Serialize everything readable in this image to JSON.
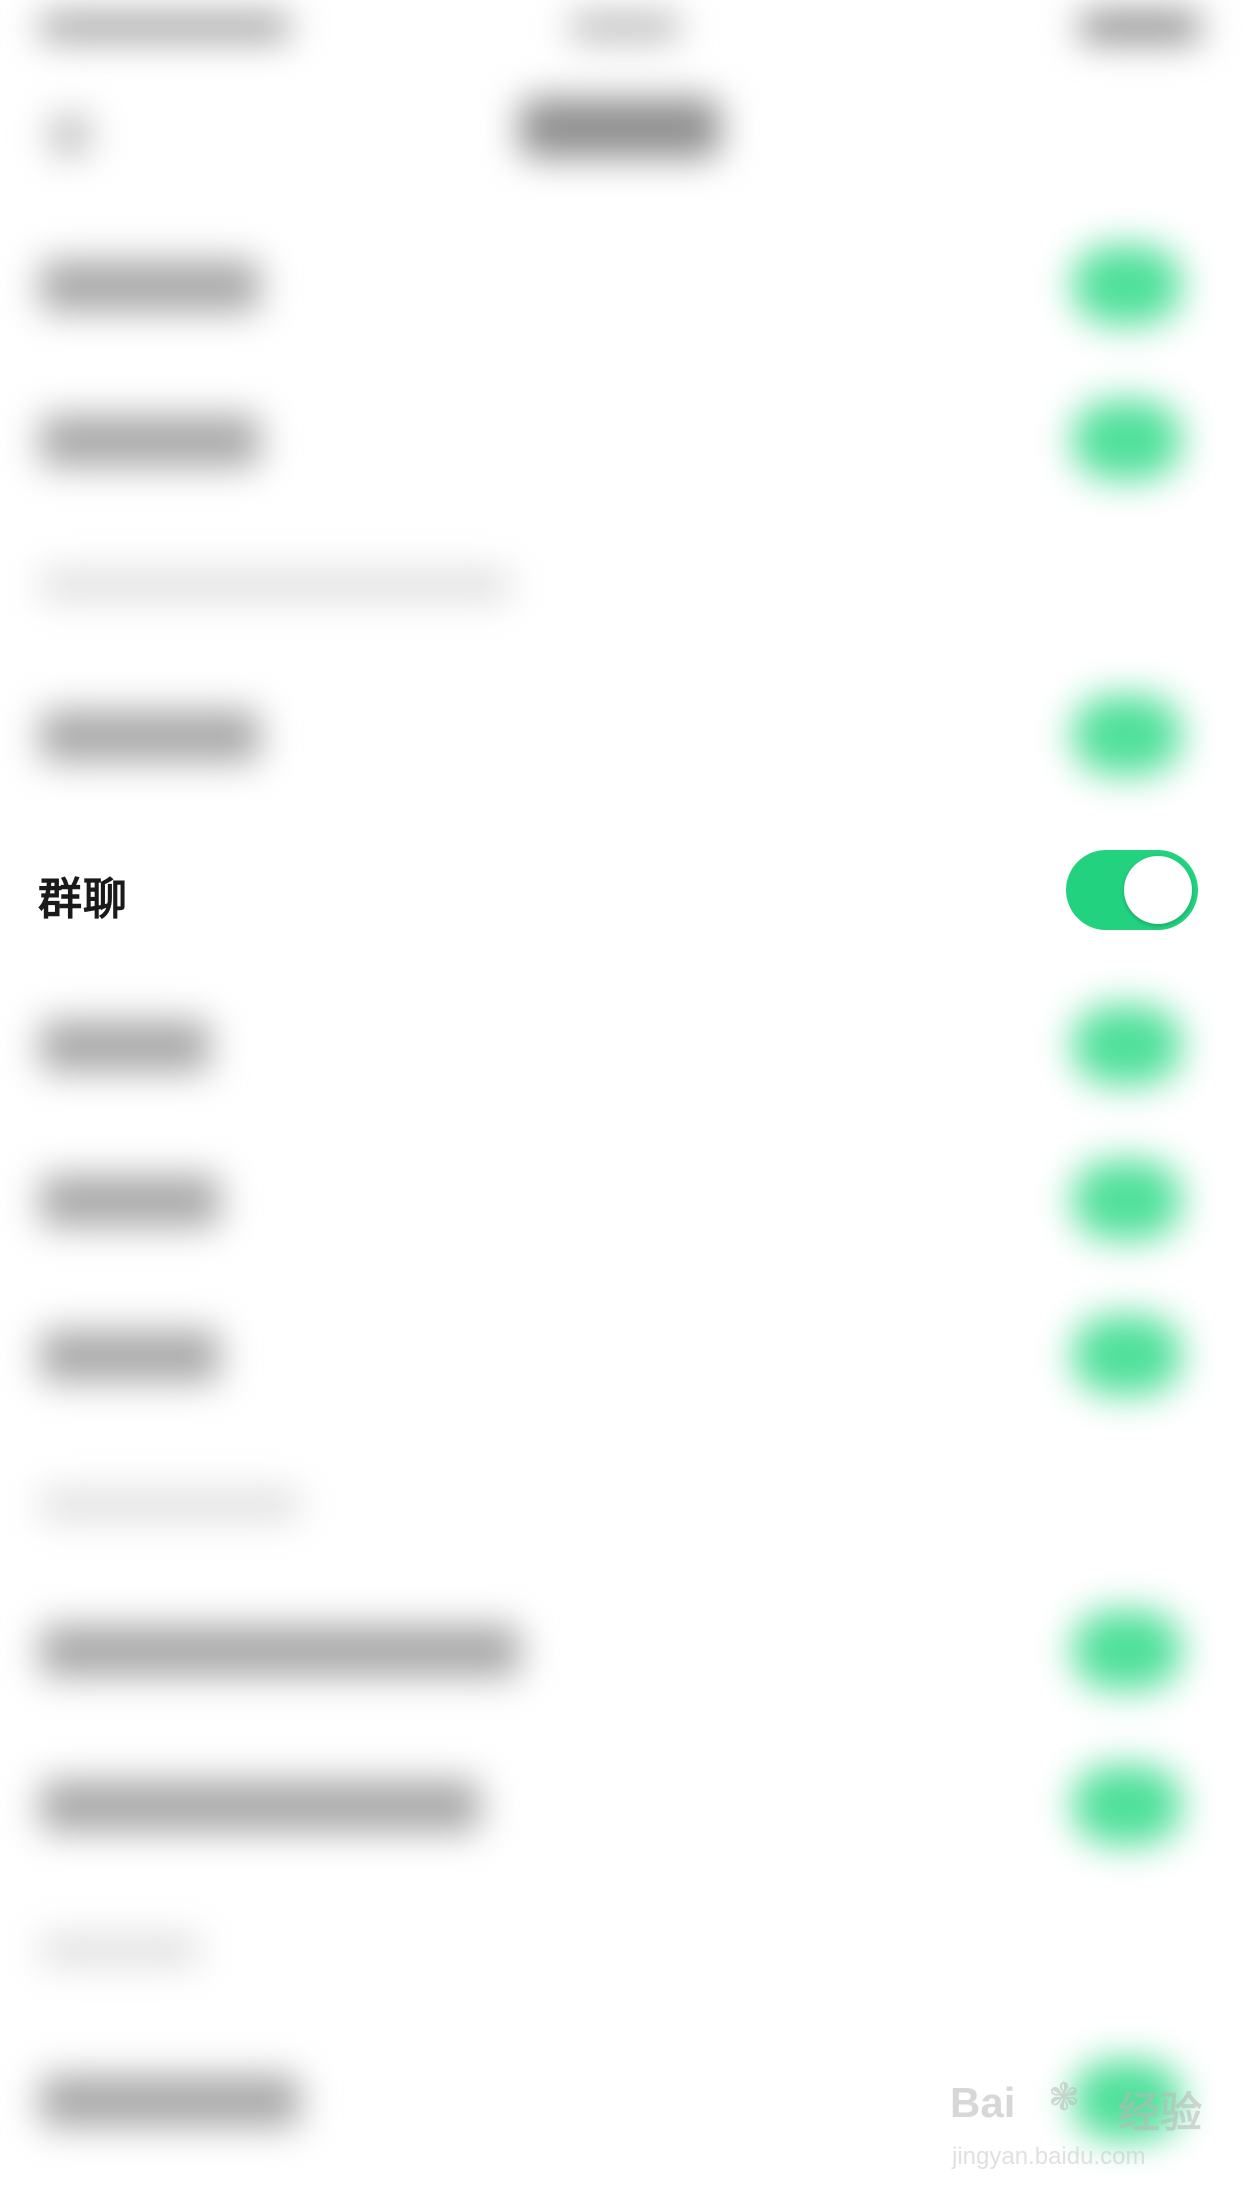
{
  "settings": {
    "group_chat": {
      "label": "群聊",
      "toggle_state": "on"
    }
  },
  "colors": {
    "toggle_on": "#22d27f",
    "background": "#ffffff"
  },
  "watermark": {
    "brand": "Bai",
    "brand_suffix": "经验",
    "url": "jingyan.baidu.com"
  }
}
